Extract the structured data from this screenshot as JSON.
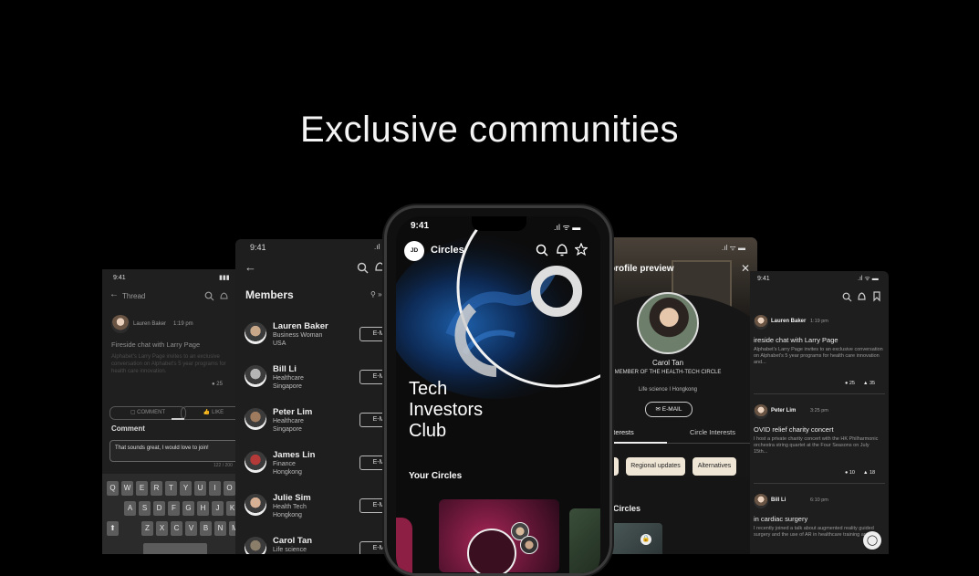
{
  "headline": "Exclusive communities",
  "thread_screen": {
    "time": "9:41",
    "title": "Thread",
    "author": "Lauren Baker",
    "post_time": "1:19 pm",
    "post_title": "Fireside chat with Larry Page",
    "post_text": "Alphabet's Larry Page invites to an exclusive conversation on Alphabet's 5 year programs for health care innovation.",
    "stat_comments": "25",
    "comment_button": "COMMENT",
    "like_button": "LIKE",
    "comment_heading": "Comment",
    "comment_input_value": "That sounds great, I would love to join!",
    "char_count": "122 / 200",
    "keyboard_row1": [
      "Q",
      "W",
      "E",
      "R",
      "T",
      "Y",
      "U",
      "I",
      "O"
    ],
    "keyboard_row2": [
      "A",
      "S",
      "D",
      "F",
      "G",
      "H",
      "J",
      "K"
    ],
    "keyboard_row3": [
      "Z",
      "X",
      "C",
      "V",
      "B",
      "N",
      "M"
    ]
  },
  "members_screen": {
    "time": "9:41",
    "title": "Members",
    "email_label": "E-M",
    "members": [
      {
        "name": "Lauren Baker",
        "line1": "Business Woman",
        "line2": "USA"
      },
      {
        "name": "Bill Li",
        "line1": "Healthcare",
        "line2": "Singapore"
      },
      {
        "name": "Peter Lim",
        "line1": "Healthcare",
        "line2": "Singapore"
      },
      {
        "name": "James Lin",
        "line1": "Finance",
        "line2": "Hongkong"
      },
      {
        "name": "Julie Sim",
        "line1": "Health Tech",
        "line2": "Hongkong"
      },
      {
        "name": "Carol Tan",
        "line1": "Life science",
        "line2": ""
      }
    ]
  },
  "center_screen": {
    "time": "9:41",
    "avatar_initials": "JD",
    "title": "Circles",
    "hero_line1": "Tech",
    "hero_line2": "Investors",
    "hero_line3": "Club",
    "section_title": "Your Circles"
  },
  "profile_screen": {
    "title": "profile preview",
    "name": "Carol Tan",
    "role": "MEMBER OF THE HEALTH-TECH CIRCLE",
    "location": "Life science I Hongkong",
    "email_button": "E-MAIL",
    "tab_interests": "Interests",
    "tab_circle_interests": "Circle Interests",
    "chips": [
      "os",
      "Regional updates",
      "Alternatives"
    ],
    "circles_heading": "r Circles"
  },
  "feed_screen": {
    "time": "9:41",
    "posts": [
      {
        "author": "Lauren Baker",
        "time": "1:19 pm",
        "title": "ireside chat with Larry Page",
        "text": "Alphabet's Larry Page invites to an exclusive conversation on Alphabet's 5 year programs for health care innovation and...",
        "c": "25",
        "l": "35"
      },
      {
        "author": "Peter Lim",
        "time": "3:25 pm",
        "title": "OVID relief charity concert",
        "text": "I host a private charity concert with the HK Philharmonic orchestra string quartet at the Four Seasons on July 15th...",
        "c": "10",
        "l": "18"
      },
      {
        "author": "Bill Li",
        "time": "6:10 pm",
        "title": "in cardiac surgery",
        "text": "I recently joined a talk about augmented reality guided surgery and the use of AR in healthcare training and...",
        "c": "",
        "l": ""
      }
    ]
  }
}
